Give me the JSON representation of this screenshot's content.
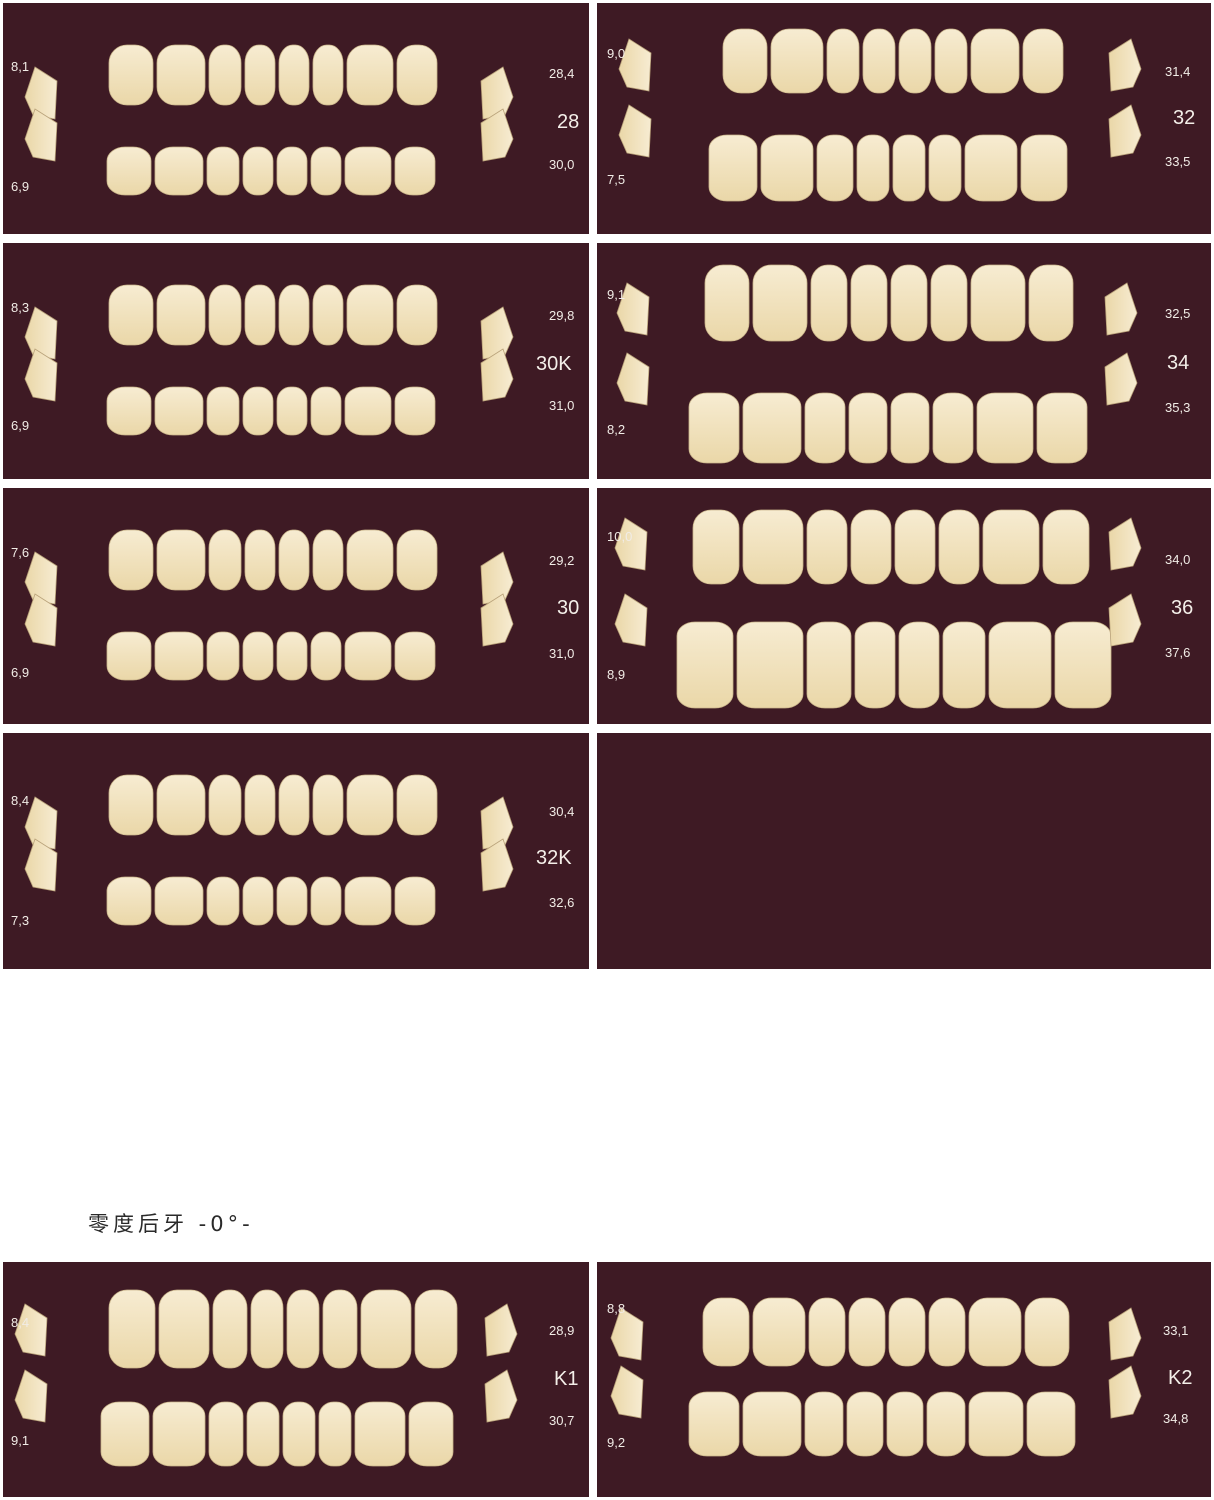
{
  "section_title": "零度后牙 -0°-",
  "colors": {
    "panel_bg": "#3e1a24",
    "tooth_light": "#f7ecd2",
    "tooth_mid": "#ead7a8",
    "label_text": "#f1ece6"
  },
  "panels": [
    {
      "id": "28",
      "code": "28",
      "left_top": "8,1",
      "left_bottom": "6,9",
      "right_top": "28,4",
      "right_bottom": "30,0"
    },
    {
      "id": "32",
      "code": "32",
      "left_top": "9,0",
      "left_bottom": "7,5",
      "right_top": "31,4",
      "right_bottom": "33,5"
    },
    {
      "id": "30K",
      "code": "30K",
      "left_top": "8,3",
      "left_bottom": "6,9",
      "right_top": "29,8",
      "right_bottom": "31,0"
    },
    {
      "id": "34",
      "code": "34",
      "left_top": "9,1",
      "left_bottom": "8,2",
      "right_top": "32,5",
      "right_bottom": "35,3"
    },
    {
      "id": "30",
      "code": "30",
      "left_top": "7,6",
      "left_bottom": "6,9",
      "right_top": "29,2",
      "right_bottom": "31,0"
    },
    {
      "id": "36",
      "code": "36",
      "left_top": "10,0",
      "left_bottom": "8,9",
      "right_top": "34,0",
      "right_bottom": "37,6"
    },
    {
      "id": "32K",
      "code": "32K",
      "left_top": "8,4",
      "left_bottom": "7,3",
      "right_top": "30,4",
      "right_bottom": "32,6"
    },
    {
      "id": "empty",
      "code": "",
      "left_top": "",
      "left_bottom": "",
      "right_top": "",
      "right_bottom": ""
    },
    {
      "id": "K1",
      "code": "K1",
      "left_top": "8,4",
      "left_bottom": "9,1",
      "right_top": "28,9",
      "right_bottom": "30,7"
    },
    {
      "id": "K2",
      "code": "K2",
      "left_top": "8,8",
      "left_bottom": "9,2",
      "right_top": "33,1",
      "right_bottom": "34,8"
    }
  ]
}
